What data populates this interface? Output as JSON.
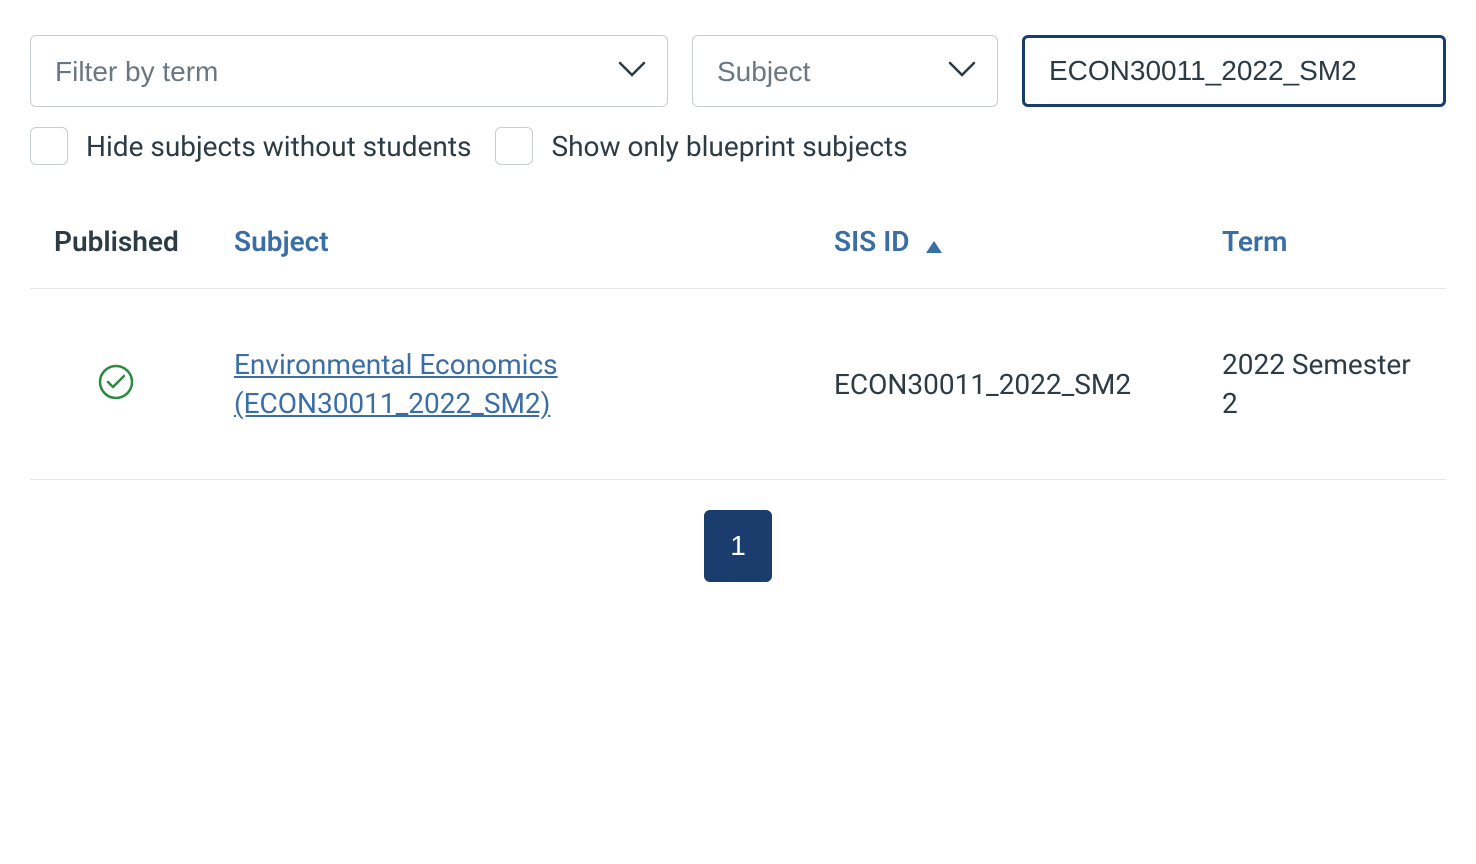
{
  "filters": {
    "term_placeholder": "Filter by term",
    "subject_placeholder": "Subject",
    "search_value": "ECON30011_2022_SM2"
  },
  "checkboxes": {
    "hide_without_students": "Hide subjects without students",
    "show_blueprint": "Show only blueprint subjects"
  },
  "table": {
    "headers": {
      "published": "Published",
      "subject": "Subject",
      "sis_id": "SIS ID",
      "term": "Term"
    },
    "rows": [
      {
        "published": true,
        "subject": "Environmental Economics (ECON30011_2022_SM2)",
        "sis_id": "ECON30011_2022_SM2",
        "term": "2022 Semester 2"
      }
    ]
  },
  "pagination": {
    "current": "1"
  }
}
